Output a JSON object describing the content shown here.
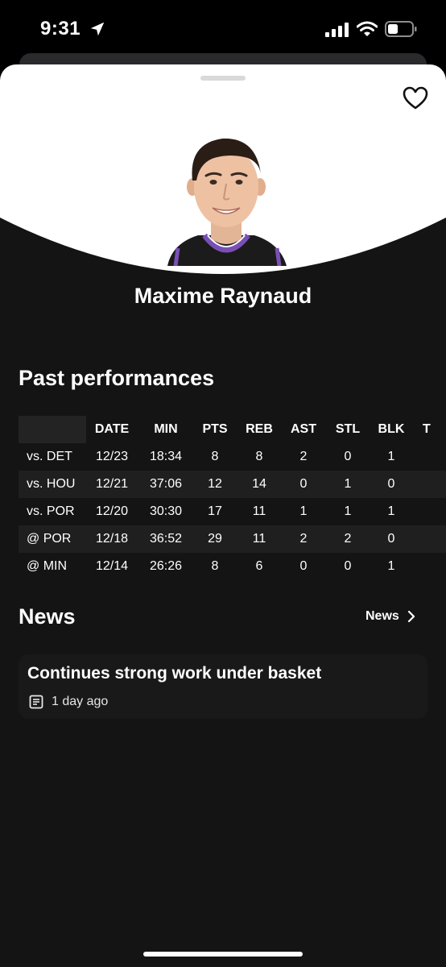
{
  "status_bar": {
    "time": "9:31",
    "icons": [
      "location-arrow-icon",
      "signal-icon",
      "wifi-icon",
      "battery-icon"
    ]
  },
  "player": {
    "name": "Maxime Raynaud",
    "favorite_icon": "heart-outline-icon",
    "jersey_color": "#6b3fa0"
  },
  "performances": {
    "title": "Past performances",
    "columns": [
      "DATE",
      "MIN",
      "PTS",
      "REB",
      "AST",
      "STL",
      "BLK",
      "T"
    ],
    "rows": [
      {
        "opp": "vs. DET",
        "date": "12/23",
        "min": "18:34",
        "pts": "8",
        "reb": "8",
        "ast": "2",
        "stl": "0",
        "blk": "1"
      },
      {
        "opp": "vs. HOU",
        "date": "12/21",
        "min": "37:06",
        "pts": "12",
        "reb": "14",
        "ast": "0",
        "stl": "1",
        "blk": "0"
      },
      {
        "opp": "vs. POR",
        "date": "12/20",
        "min": "30:30",
        "pts": "17",
        "reb": "11",
        "ast": "1",
        "stl": "1",
        "blk": "1"
      },
      {
        "opp": "@ POR",
        "date": "12/18",
        "min": "36:52",
        "pts": "29",
        "reb": "11",
        "ast": "2",
        "stl": "2",
        "blk": "0"
      },
      {
        "opp": "@ MIN",
        "date": "12/14",
        "min": "26:26",
        "pts": "8",
        "reb": "6",
        "ast": "0",
        "stl": "0",
        "blk": "1"
      }
    ]
  },
  "news": {
    "title": "News",
    "link_label": "News",
    "items": [
      {
        "headline": "Continues strong work under basket",
        "time": "1 day ago",
        "icon": "article-icon"
      }
    ]
  },
  "colors": {
    "background": "#000000",
    "sheet": "#141414",
    "row_alt": "#1f1f1f",
    "card": "#191919",
    "hero": "#ffffff"
  }
}
